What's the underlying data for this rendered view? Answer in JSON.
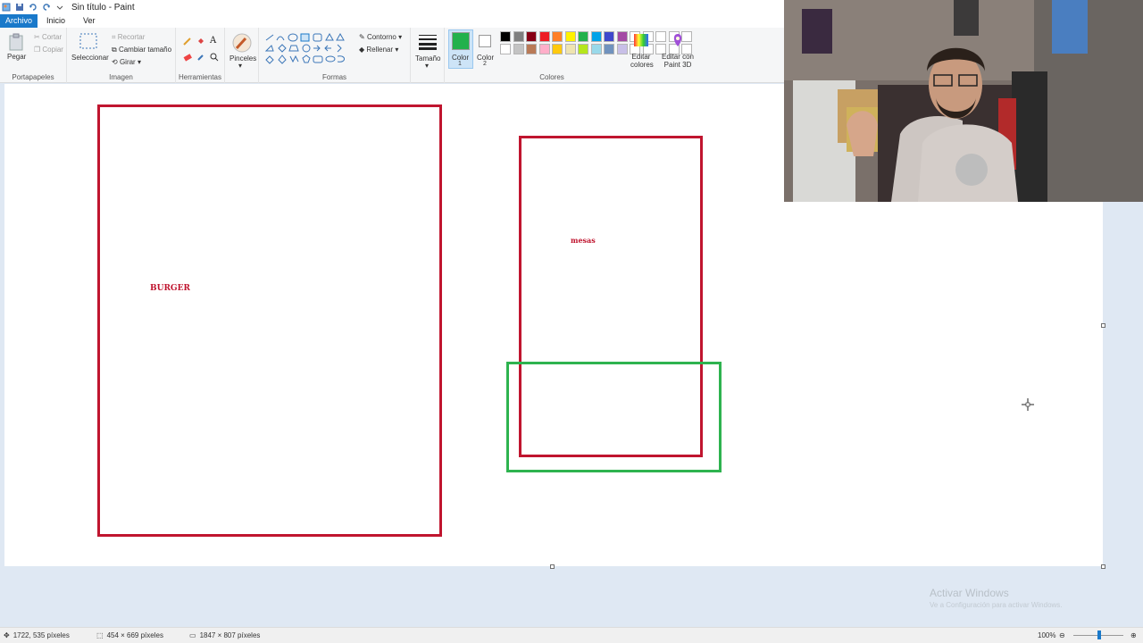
{
  "window": {
    "title": "Sin título - Paint"
  },
  "tabs": [
    {
      "label": "Archivo"
    },
    {
      "label": "Inicio"
    },
    {
      "label": "Ver"
    }
  ],
  "ribbon": {
    "clipboard": {
      "paste": "Pegar",
      "cut": "Cortar",
      "copy": "Copiar",
      "group": "Portapapeles"
    },
    "image": {
      "select": "Seleccionar",
      "crop": "Recortar",
      "resize": "Cambiar tamaño",
      "rotate": "Girar",
      "group": "Imagen"
    },
    "tools": {
      "group": "Herramientas"
    },
    "brushes": {
      "label": "Pinceles"
    },
    "shapes": {
      "outline": "Contorno",
      "fill": "Rellenar",
      "group": "Formas"
    },
    "size": {
      "label": "Tamaño"
    },
    "colors": {
      "color1": "Color",
      "color1_num": "1",
      "color2": "Color",
      "color2_num": "2",
      "edit": "Editar colores",
      "paint3d": "Editar con Paint 3D",
      "group": "Colores",
      "color1_value": "#22b14c",
      "color2_value": "#ffffff",
      "palette_row1": [
        "#000000",
        "#7f7f7f",
        "#880015",
        "#ed1c24",
        "#ff7f27",
        "#fff200",
        "#22b14c",
        "#00a2e8",
        "#3f48cc",
        "#a349a4"
      ],
      "palette_row2": [
        "#ffffff",
        "#c3c3c3",
        "#b97a57",
        "#ffaec9",
        "#ffc90e",
        "#efe4b0",
        "#b5e61d",
        "#99d9ea",
        "#7092be",
        "#c8bfe7"
      ]
    }
  },
  "canvas": {
    "burger_label": "BURGER",
    "mesas_label": "mesas",
    "red": "#c0152f",
    "green": "#2eb34f"
  },
  "watermark": {
    "title": "Activar Windows",
    "subtitle": "Ve a Configuración para activar Windows."
  },
  "status": {
    "cursor_pos": "1722, 535 píxeles",
    "selection_size": "454 × 669 píxeles",
    "image_size": "1847 × 807 píxeles",
    "zoom": "100%"
  }
}
